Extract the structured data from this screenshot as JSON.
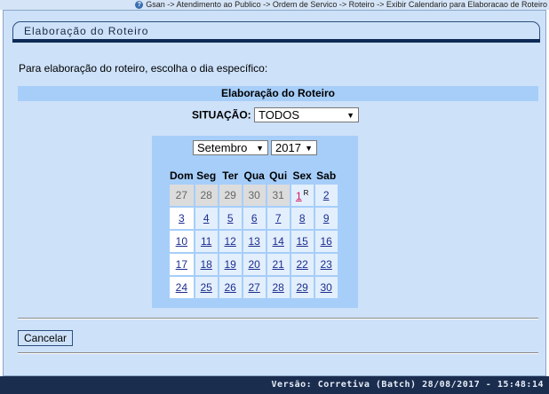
{
  "breadcrumb": {
    "help_glyph": "?",
    "path": "Gsan -> Atendimento ao Publico -> Ordem de Servico -> Roteiro -> Exibir Calendario para Elaboracao de Roteiro"
  },
  "panel": {
    "title": "Elaboração do Roteiro",
    "intro": "Para elaboração do roteiro, escolha o dia específico:",
    "section_header": "Elaboração do Roteiro"
  },
  "situacao": {
    "label": "SITUAÇÃO:",
    "value": "TODOS"
  },
  "calendar": {
    "month": "Setembro",
    "year": "2017",
    "weekdays": [
      "Dom",
      "Seg",
      "Ter",
      "Qua",
      "Qui",
      "Sex",
      "Sab"
    ],
    "weeks": [
      [
        {
          "d": "27",
          "other": true
        },
        {
          "d": "28",
          "other": true
        },
        {
          "d": "29",
          "other": true
        },
        {
          "d": "30",
          "other": true
        },
        {
          "d": "31",
          "other": true
        },
        {
          "d": "1",
          "mark": "R",
          "holiday": true
        },
        {
          "d": "2"
        }
      ],
      [
        {
          "d": "3"
        },
        {
          "d": "4"
        },
        {
          "d": "5"
        },
        {
          "d": "6"
        },
        {
          "d": "7"
        },
        {
          "d": "8"
        },
        {
          "d": "9"
        }
      ],
      [
        {
          "d": "10"
        },
        {
          "d": "11"
        },
        {
          "d": "12"
        },
        {
          "d": "13"
        },
        {
          "d": "14"
        },
        {
          "d": "15"
        },
        {
          "d": "16"
        }
      ],
      [
        {
          "d": "17"
        },
        {
          "d": "18"
        },
        {
          "d": "19"
        },
        {
          "d": "20"
        },
        {
          "d": "21"
        },
        {
          "d": "22"
        },
        {
          "d": "23"
        }
      ],
      [
        {
          "d": "24"
        },
        {
          "d": "25"
        },
        {
          "d": "26"
        },
        {
          "d": "27"
        },
        {
          "d": "28"
        },
        {
          "d": "29"
        },
        {
          "d": "30"
        }
      ]
    ]
  },
  "actions": {
    "cancel_label": "Cancelar"
  },
  "footer": {
    "version": "Versão: Corretiva (Batch) 28/08/2017 - 15:48:14"
  },
  "colors": {
    "panel_bg": "#cde1f9",
    "header_bg": "#a6cef9",
    "footer_bg": "#1b2d4f",
    "link": "#1d2d8f",
    "holiday_link": "#d4145a"
  }
}
